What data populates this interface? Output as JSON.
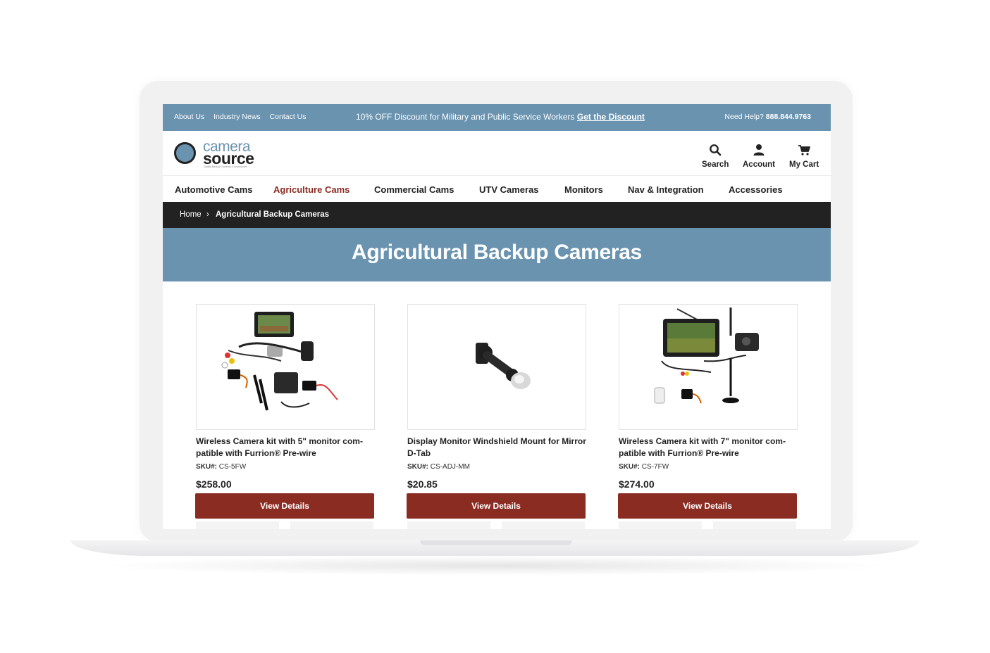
{
  "topbar": {
    "links": [
      "About Us",
      "Industry News",
      "Contact Us"
    ],
    "promo_text": "10% OFF Discount for Military and Public Service Workers",
    "promo_link": "Get the Discount",
    "help_label": "Need Help?",
    "help_phone": "888.844.9763"
  },
  "logo": {
    "line1": "camera",
    "line2": "source",
    "tagline": "Quality Backup Cameras & Accessories"
  },
  "header_actions": {
    "search": "Search",
    "account": "Account",
    "cart": "My Cart"
  },
  "nav": [
    {
      "label": "Automotive Cams",
      "active": false
    },
    {
      "label": "Agriculture Cams",
      "active": true
    },
    {
      "label": "Commercial Cams",
      "active": false
    },
    {
      "label": "UTV Cameras",
      "active": false
    },
    {
      "label": "Monitors",
      "active": false
    },
    {
      "label": "Nav & Integration",
      "active": false
    },
    {
      "label": "Accessories",
      "active": false
    }
  ],
  "breadcrumb": {
    "home": "Home",
    "separator": "›",
    "current": "Agricultural Backup Cameras"
  },
  "page_title": "Agricultural Backup Cameras",
  "products": [
    {
      "name": "Wireless Camera kit with 5\" monitor com-patible with Furrion® Pre-wire",
      "sku_label": "SKU#:",
      "sku": "CS-5FW",
      "price": "$258.00",
      "button": "View Details"
    },
    {
      "name": "Display Monitor Windshield Mount for Mirror D-Tab",
      "sku_label": "SKU#:",
      "sku": "CS-ADJ-MM",
      "price": "$20.85",
      "button": "View Details"
    },
    {
      "name": "Wireless Camera kit with 7\" monitor com-patible with Furrion® Pre-wire",
      "sku_label": "SKU#:",
      "sku": "CS-7FW",
      "price": "$274.00",
      "button": "View Details"
    }
  ],
  "colors": {
    "brand_blue": "#6a93b0",
    "brand_red": "#8b2c22",
    "dark_bar": "#222222"
  }
}
